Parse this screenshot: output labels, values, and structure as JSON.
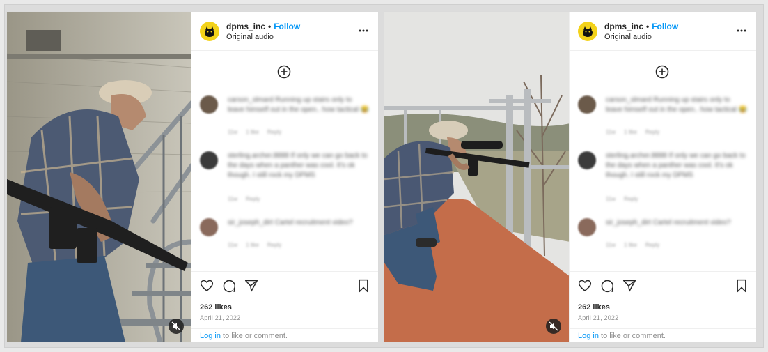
{
  "posts": [
    {
      "account": "dpms_inc",
      "separator": "•",
      "follow_label": "Follow",
      "audio": "Original audio",
      "more_icon": "more-options-icon",
      "comments": [
        {
          "text": "carson_slmard Running up stairs only to leave himself out in the open.. how tactical 😂",
          "meta": [
            "11w",
            "1 like",
            "Reply"
          ]
        },
        {
          "text": "sterling.archer.8888 If only we can go back to the days when a panther was cool. It's ok though. I still rock my DPMS",
          "meta": [
            "11w",
            "Reply"
          ]
        },
        {
          "text": "sir_joseph_dirt Cartel recruitment video?",
          "meta": [
            "11w",
            "1 like",
            "Reply"
          ]
        }
      ],
      "likes": "262 likes",
      "date": "April 21, 2022",
      "login_link": "Log in",
      "login_rest": " to like or comment."
    },
    {
      "account": "dpms_inc",
      "separator": "•",
      "follow_label": "Follow",
      "audio": "Original audio",
      "more_icon": "more-options-icon",
      "comments": [
        {
          "text": "carson_slmard Running up stairs only to leave himself out in the open.. how tactical 😂",
          "meta": [
            "11w",
            "1 like",
            "Reply"
          ]
        },
        {
          "text": "sterling.archer.8888 If only we can go back to the days when a panther was cool. It's ok though. I still rock my DPMS",
          "meta": [
            "11w",
            "Reply"
          ]
        },
        {
          "text": "sir_joseph_dirt Cartel recruitment video?",
          "meta": [
            "11w",
            "1 like",
            "Reply"
          ]
        }
      ],
      "likes": "262 likes",
      "date": "April 21, 2022",
      "login_link": "Log in",
      "login_rest": " to like or comment."
    }
  ],
  "colors": {
    "link": "#0095f6",
    "brand_logo": "#f3d21a",
    "muted_text": "#8e8e8e"
  }
}
